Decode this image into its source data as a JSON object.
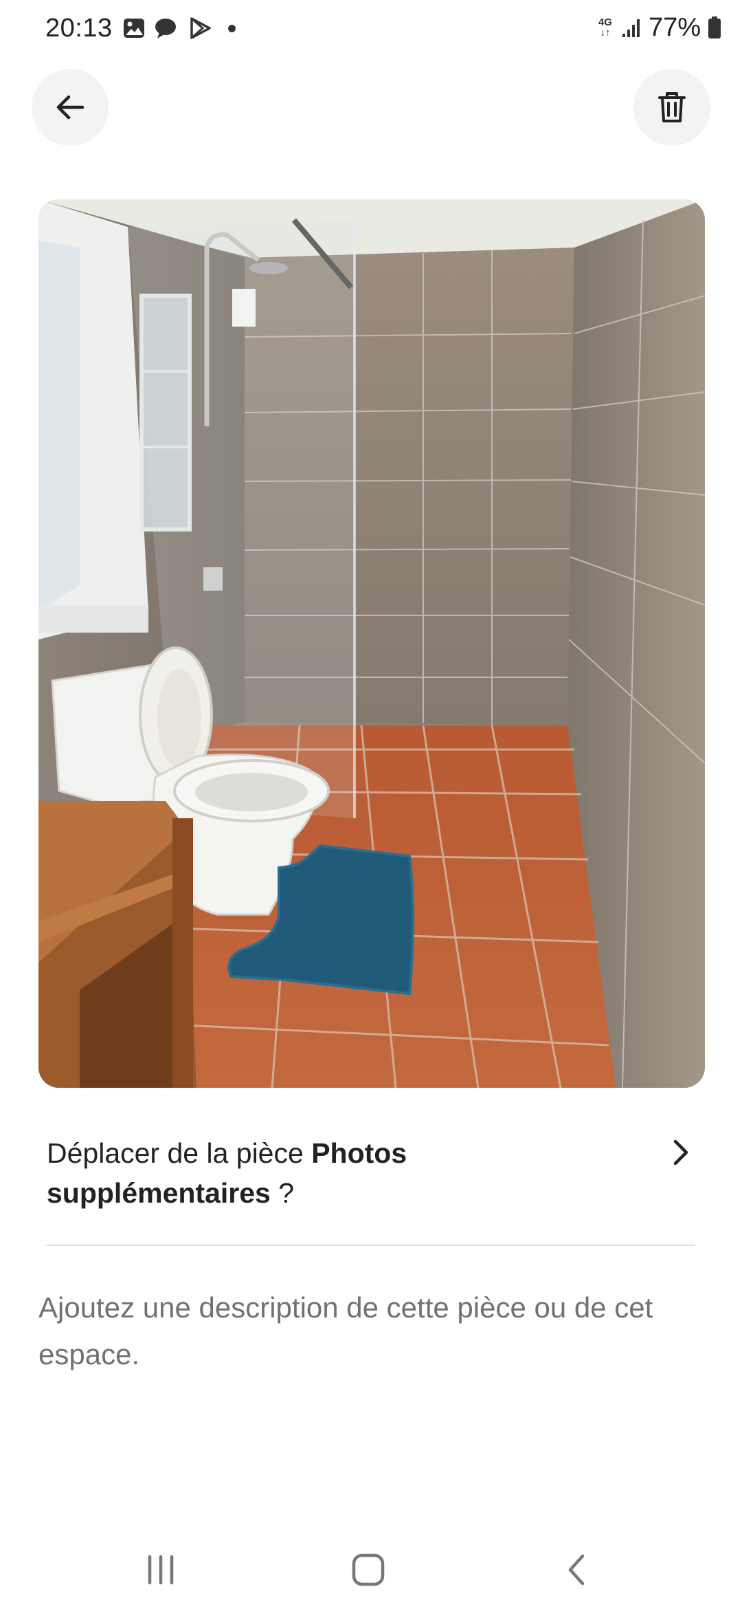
{
  "status_bar": {
    "time": "20:13",
    "network_top": "4G",
    "network_bottom": "↓↑",
    "battery": "77%"
  },
  "toolbar": {
    "back_icon": "arrow-left-icon",
    "delete_icon": "trash-icon"
  },
  "photo": {
    "subject": "bathroom-photo"
  },
  "move_room": {
    "prefix": "Déplacer de la pièce ",
    "room_name": "Photos supplémentaires",
    "suffix": " ?",
    "chevron_icon": "chevron-right-icon"
  },
  "description": {
    "placeholder": "Ajoutez une description de cette pièce ou de cet espace.",
    "value": ""
  },
  "nav": {
    "recents_icon": "recents-icon",
    "home_icon": "home-icon",
    "back_icon": "nav-back-icon"
  },
  "colors": {
    "text_primary": "#222222",
    "text_secondary": "#717171",
    "button_bg": "#f3f3f3",
    "divider": "#dddddd"
  }
}
